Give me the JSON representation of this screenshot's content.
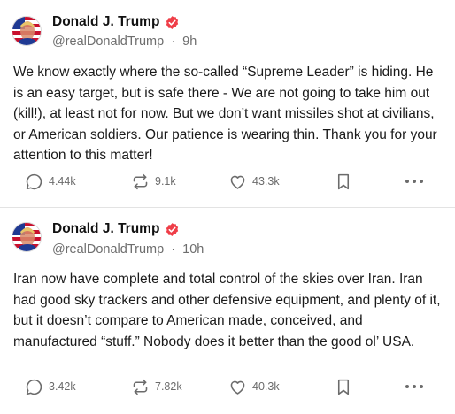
{
  "colors": {
    "verified_badge": "#ef3e48",
    "text": "#1a1a1a",
    "secondary_text": "#6e6e6e",
    "icon": "#6b6b6b"
  },
  "posts": [
    {
      "author": {
        "display_name": "Donald J. Trump",
        "handle": "@realDonaldTrump",
        "separator": "·",
        "time": "9h",
        "verified": true,
        "avatar_icon": "flag-portrait-avatar"
      },
      "text": "We know exactly where the so-called “Supreme Leader” is hiding. He is an easy target, but is safe there - We are not going to take him out (kill!), at least not for now. But we don’t want missiles shot at civilians, or American soldiers. Our patience is wearing thin. Thank you for your attention to this matter!",
      "stats": {
        "replies": "4.44k",
        "retruths": "9.1k",
        "likes": "43.3k"
      }
    },
    {
      "author": {
        "display_name": "Donald J. Trump",
        "handle": "@realDonaldTrump",
        "separator": "·",
        "time": "10h",
        "verified": true,
        "avatar_icon": "flag-portrait-avatar"
      },
      "text": "Iran now have complete and total control of the skies over Iran. Iran had good sky trackers and other defensive equipment, and plenty of it, but it doesn’t compare to American made, conceived, and manufactured “stuff.”  Nobody does it better than the good ol’ USA.",
      "stats": {
        "replies": "3.42k",
        "retruths": "7.82k",
        "likes": "40.3k"
      }
    }
  ]
}
